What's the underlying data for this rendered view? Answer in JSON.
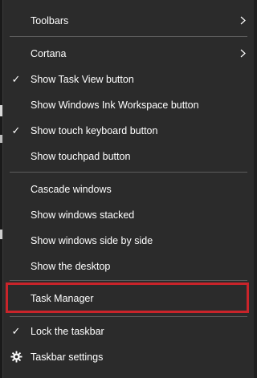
{
  "menu": {
    "items": [
      {
        "label": "Toolbars",
        "checked": false,
        "submenu": true
      },
      {
        "label": "Cortana",
        "checked": false,
        "submenu": true
      },
      {
        "label": "Show Task View button",
        "checked": true
      },
      {
        "label": "Show Windows Ink Workspace button",
        "checked": false
      },
      {
        "label": "Show touch keyboard button",
        "checked": true
      },
      {
        "label": "Show touchpad button",
        "checked": false
      },
      {
        "label": "Cascade windows",
        "checked": false
      },
      {
        "label": "Show windows stacked",
        "checked": false
      },
      {
        "label": "Show windows side by side",
        "checked": false
      },
      {
        "label": "Show the desktop",
        "checked": false
      },
      {
        "label": "Task Manager",
        "checked": false,
        "highlighted": true
      },
      {
        "label": "Lock the taskbar",
        "checked": true
      },
      {
        "label": "Taskbar settings",
        "icon": "gear-icon"
      }
    ],
    "check_glyph": "✓",
    "highlight_color": "#c9242a",
    "background_color": "#2b2b2b",
    "text_color": "#ffffff"
  }
}
